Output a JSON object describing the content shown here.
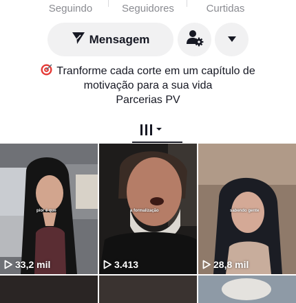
{
  "stats": [
    {
      "label": "Seguindo"
    },
    {
      "label": "Seguidores"
    },
    {
      "label": "Curtidas"
    }
  ],
  "actions": {
    "message_label": "Mensagem",
    "message_icon": "send-icon",
    "add_friend_icon": "add-friend-gear-icon",
    "more_icon": "dropdown-triangle-icon"
  },
  "bio": {
    "emoji": "target-emoji",
    "line1": "Tranforme cada corte em um capítulo de",
    "line2": "motivação para a sua vida",
    "line3": "Parcerias PV"
  },
  "tabs": {
    "active_icon": "grid-videos-icon"
  },
  "videos": [
    {
      "caption": "pior é que",
      "views": "33,2 mil"
    },
    {
      "caption": "a formalização",
      "views": "3.413"
    },
    {
      "caption": "sabendo gente",
      "views": "28,8 mil"
    }
  ],
  "colors": {
    "text": "#161823",
    "muted": "#8a8b91",
    "button_bg": "#f1f1f2"
  }
}
